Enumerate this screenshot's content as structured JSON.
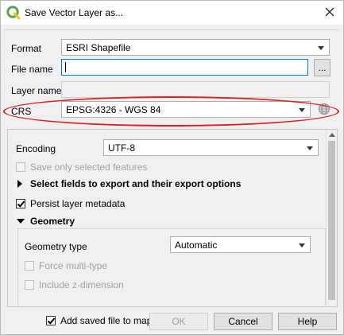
{
  "window": {
    "title": "Save Vector Layer as..."
  },
  "form": {
    "format_label": "Format",
    "format_value": "ESRI Shapefile",
    "filename_label": "File name",
    "filename_value": "",
    "browse_label": "...",
    "layername_label": "Layer name",
    "layername_value": "",
    "crs_label": "CRS",
    "crs_value": "EPSG:4326 - WGS 84"
  },
  "options": {
    "encoding_label": "Encoding",
    "encoding_value": "UTF-8",
    "save_selected_label": "Save only selected features",
    "save_selected_checked": false,
    "select_fields_label": "Select fields to export and their export options",
    "persist_metadata_label": "Persist layer metadata",
    "persist_metadata_checked": true,
    "geometry_header": "Geometry",
    "geometry_type_label": "Geometry type",
    "geometry_type_value": "Automatic",
    "force_multi_label": "Force multi-type",
    "include_z_label": "Include z-dimension"
  },
  "footer": {
    "add_saved_label": "Add saved file to map",
    "add_saved_checked": true,
    "ok_label": "OK",
    "cancel_label": "Cancel",
    "help_label": "Help"
  },
  "colors": {
    "highlight_ellipse": "#e02020",
    "qgis_green": "#58a846",
    "focus_border": "#0078d7"
  }
}
